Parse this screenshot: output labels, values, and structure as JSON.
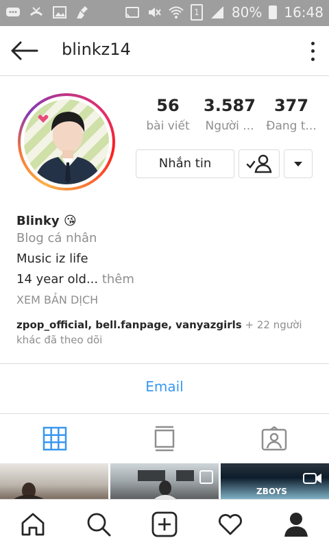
{
  "status_bar": {
    "battery_text": "80%",
    "time": "16:48",
    "sim_slot": "1"
  },
  "header": {
    "username": "blinkz14"
  },
  "profile": {
    "stats": [
      {
        "value": "56",
        "label": "bài viết"
      },
      {
        "value": "3.587",
        "label": "Người ..."
      },
      {
        "value": "377",
        "label": "Đang t..."
      }
    ],
    "message_button": "Nhắn tin"
  },
  "bio": {
    "name": "Blinky 😘",
    "category": "Blog cá nhân",
    "line1": "Music iz life",
    "line2_main": "14 year old...",
    "line2_more": " thêm",
    "translate": "XEM BẢN DỊCH",
    "followed_users": "zpop_official, bell.fanpage, vanyazgirls",
    "followed_suffix": " + 22 người khác đã theo dõi"
  },
  "contact": {
    "email_label": "Email"
  },
  "grid": {
    "cell3_overlay": "ZBOYS"
  },
  "colors": {
    "link": "#3897f0",
    "muted": "#8e8e8e",
    "text": "#262626",
    "status_bar": "#9e9e9e"
  }
}
